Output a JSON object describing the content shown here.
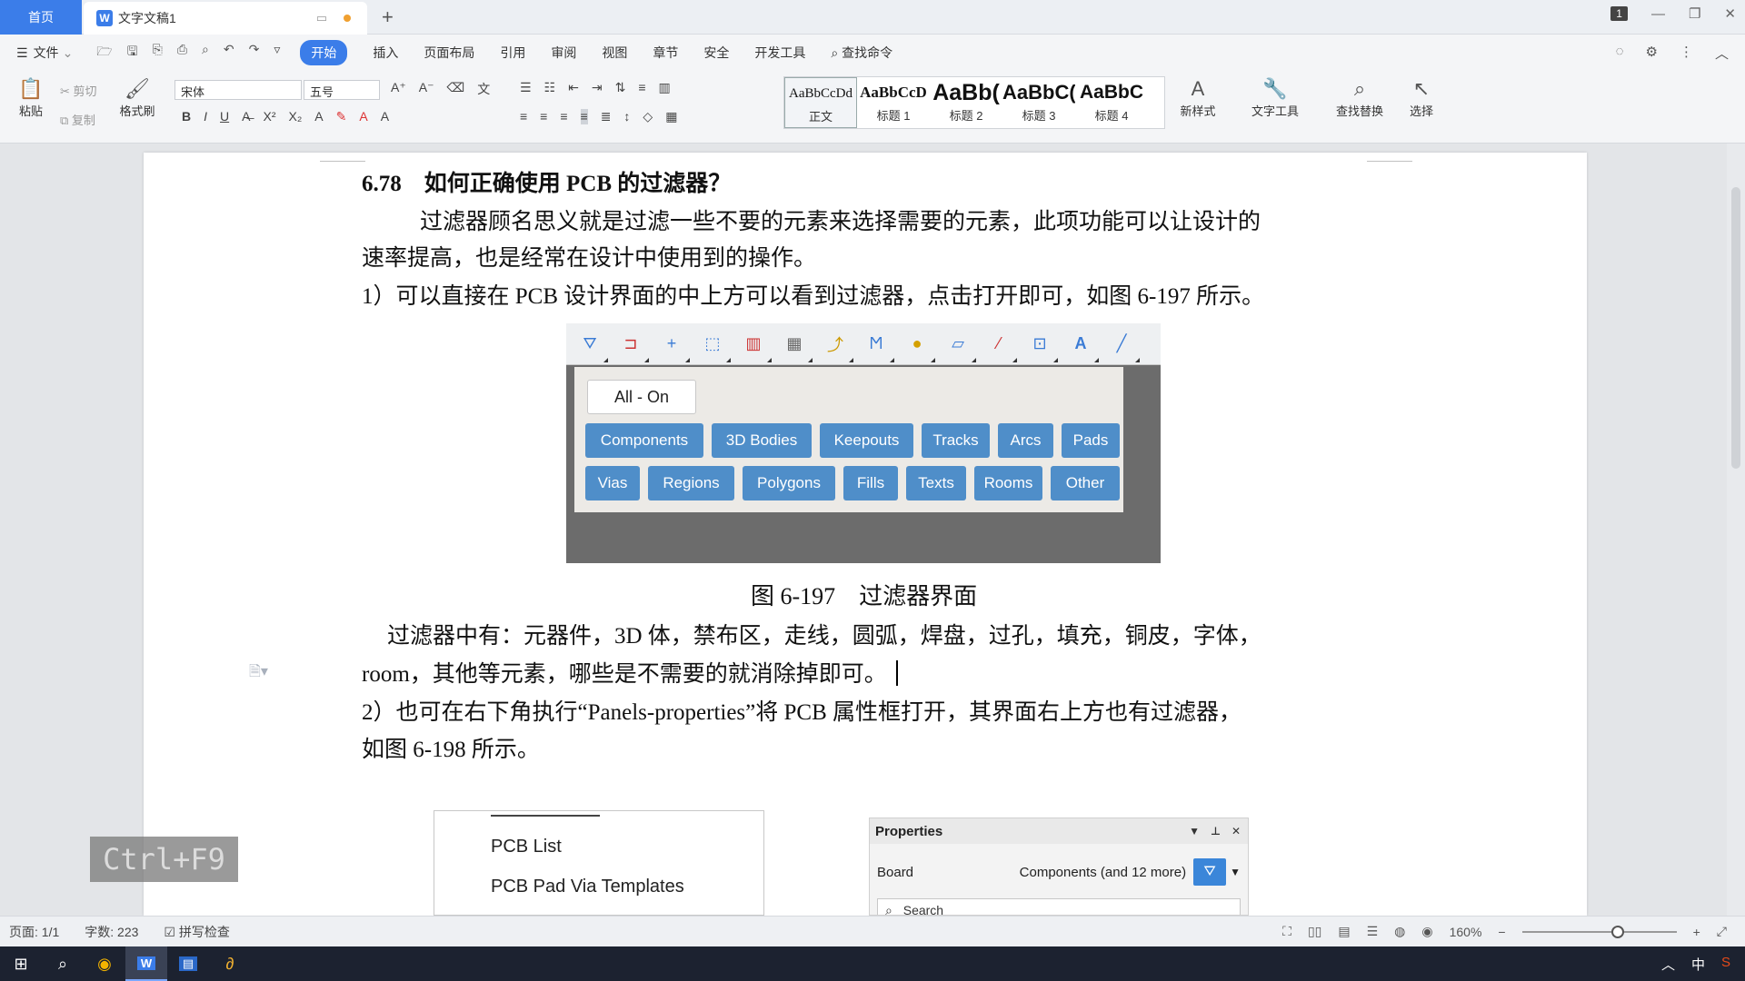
{
  "titlebar": {
    "home_tab": "首页",
    "doc_tab": "文字文稿1",
    "new_tab": "+",
    "window_badge": "1"
  },
  "menubar": {
    "file": "文件",
    "tabs": [
      "开始",
      "插入",
      "页面布局",
      "引用",
      "审阅",
      "视图",
      "章节",
      "安全",
      "开发工具"
    ],
    "search": "查找命令"
  },
  "ribbon": {
    "paste": "粘贴",
    "cut": "剪切",
    "copy": "复制",
    "format_painter": "格式刷",
    "font_name": "宋体",
    "font_size": "五号",
    "styles": [
      {
        "sample": "AaBbCcDd",
        "name": "正文"
      },
      {
        "sample": "AaBbCcD",
        "name": "标题 1"
      },
      {
        "sample": "AaBb(",
        "name": "标题 2"
      },
      {
        "sample": "AaBbC(",
        "name": "标题 3"
      },
      {
        "sample": "AaBbC",
        "name": "标题 4"
      }
    ],
    "new_style": "新样式",
    "text_tools": "文字工具",
    "find_replace": "查找替换",
    "select": "选择"
  },
  "document": {
    "heading": "6.78　如何正确使用 PCB 的过滤器？",
    "para1_line1": "过滤器顾名思义就是过滤一些不要的元素来选择需要的元素，此项功能可以让设计的",
    "para1_line2": "速率提高，也是经常在设计中使用到的操作。",
    "para2": "1）可以直接在 PCB 设计界面的中上方可以看到过滤器，点击打开即可，如图 6-197 所示。",
    "caption": "图 6-197　过滤器界面",
    "para3_line1": "过滤器中有：元器件，3D 体，禁布区，走线，圆弧，焊盘，过孔，填充，铜皮，字体，",
    "para3_line2": "room，其他等元素，哪些是不需要的就消除掉即可。",
    "para4_line1": "2）也可在右下角执行“Panels-properties”将 PCB 属性框打开，其界面右上方也有过滤器，",
    "para4_line2": "如图 6-198 所示。"
  },
  "filter_figure": {
    "all_on": "All - On",
    "row1": [
      "Components",
      "3D Bodies",
      "Keepouts",
      "Tracks",
      "Arcs",
      "Pads"
    ],
    "row2": [
      "Vias",
      "Regions",
      "Polygons",
      "Fills",
      "Texts",
      "Rooms",
      "Other"
    ]
  },
  "menu_figure": {
    "items": [
      "PCB List",
      "PCB Pad Via Templates"
    ]
  },
  "properties_figure": {
    "title": "Properties",
    "row_label": "Board",
    "row_value": "Components (and 12 more)",
    "search_placeholder": "Search"
  },
  "shortcut_overlay": "Ctrl+F9",
  "statusbar": {
    "page": "页面: 1/1",
    "word_count": "字数: 223",
    "spell_check": "拼写检查",
    "zoom": "160%"
  },
  "tray": {
    "ime": "中"
  }
}
